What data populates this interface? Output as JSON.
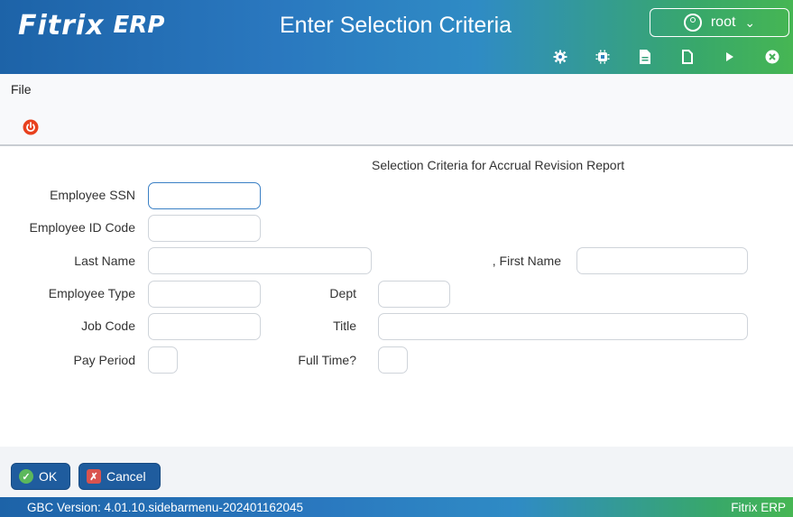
{
  "header": {
    "logo_brand": "Fitrix",
    "logo_suffix": "ERP",
    "title": "Enter Selection Criteria",
    "user": "root",
    "toolbar_icons": [
      "gear-icon",
      "chip-icon",
      "document-filled-icon",
      "document-icon",
      "play-icon",
      "close-circle-icon"
    ]
  },
  "menu": {
    "file": "File"
  },
  "form": {
    "heading": "Selection Criteria for Accrual Revision Report",
    "labels": {
      "employee_ssn": "Employee SSN",
      "employee_id_code": "Employee ID Code",
      "last_name": "Last Name",
      "first_name": ", First Name",
      "employee_type": "Employee Type",
      "dept": "Dept",
      "job_code": "Job Code",
      "title": "Title",
      "pay_period": "Pay Period",
      "full_time": "Full Time?"
    },
    "values": {
      "employee_ssn": "",
      "employee_id_code": "",
      "last_name": "",
      "first_name": "",
      "employee_type": "",
      "dept": "",
      "job_code": "",
      "title": "",
      "pay_period": "",
      "full_time": ""
    }
  },
  "buttons": {
    "ok": "OK",
    "cancel": "Cancel"
  },
  "status": {
    "version": "GBC Version: 4.01.10.sidebarmenu-202401162045",
    "product": "Fitrix ERP"
  },
  "colors": {
    "header_blue": "#1d63a8",
    "header_green": "#46b653",
    "button_blue": "#1f5c9e",
    "power_red": "#e8411e",
    "ok_green": "#5cb85c",
    "cancel_red": "#d9534f"
  }
}
